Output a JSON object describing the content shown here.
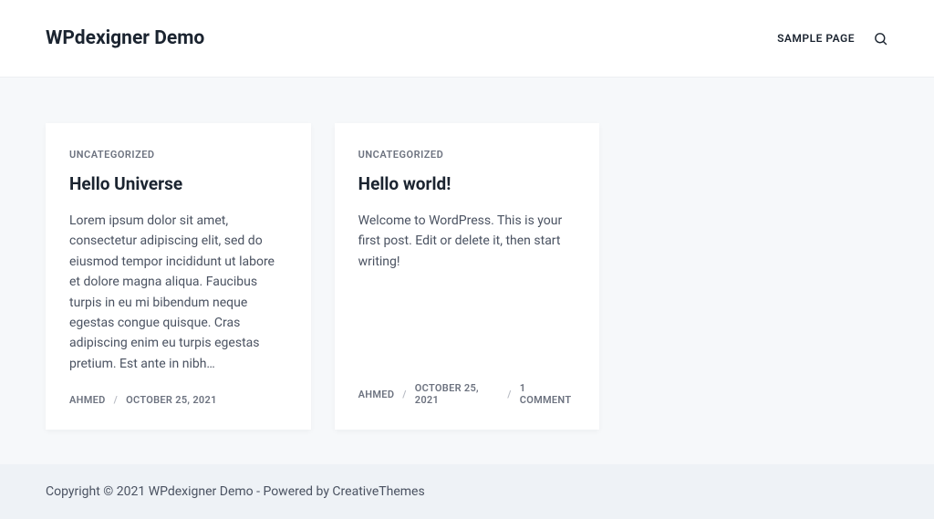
{
  "header": {
    "site_title": "WPdexigner Demo",
    "nav": {
      "sample_page": "SAMPLE PAGE"
    }
  },
  "posts": [
    {
      "category": "UNCATEGORIZED",
      "title": "Hello Universe",
      "excerpt": "Lorem ipsum dolor sit amet, consectetur adipiscing elit, sed do eiusmod tempor incididunt ut labore et dolore magna aliqua. Faucibus turpis in eu mi bibendum neque egestas congue quisque. Cras adipiscing enim eu turpis egestas pretium. Est ante in nibh…",
      "author": "AHMED",
      "date": "OCTOBER 25, 2021",
      "comments": null
    },
    {
      "category": "UNCATEGORIZED",
      "title": "Hello world!",
      "excerpt": "Welcome to WordPress. This is your first post. Edit or delete it, then start writing!",
      "author": "AHMED",
      "date": "OCTOBER 25, 2021",
      "comments": "1 COMMENT"
    }
  ],
  "footer": {
    "copyright_prefix": "Copyright © 2021 WPdexigner Demo - Powered by ",
    "powered_by": "CreativeThemes"
  }
}
